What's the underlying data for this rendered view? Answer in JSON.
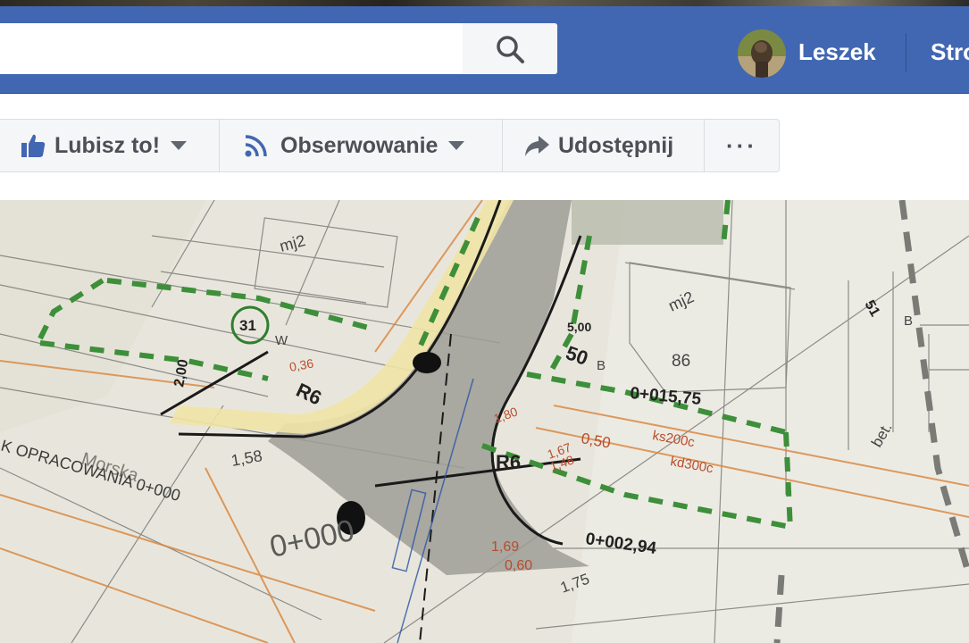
{
  "header": {
    "search": {
      "value": "",
      "placeholder": ""
    },
    "user": {
      "name": "Leszek"
    },
    "nav": {
      "home_label": "Stro"
    }
  },
  "page_actions": {
    "like_label": "Lubisz to!",
    "follow_label": "Obserwowanie",
    "share_label": "Udostępnij",
    "more_label": "···"
  },
  "cover": {
    "labels": {
      "parcel_31": "31",
      "parcel_50": "50",
      "parcel_86": "86",
      "parcel_51": "51",
      "radius_left": "R6",
      "radius_right": "R6",
      "chainage_upper": "0+015,75",
      "chainage_lower": "0+002,94",
      "chainage_zero": "0+000",
      "dim_200": "2,00",
      "dim_500": "5,00",
      "street": "Morska",
      "project_range": "K OPRACOWANIA 0+000",
      "ks200": "ks200c",
      "kd300": "kd300c",
      "val_050": "0,50",
      "val_169": "1,69",
      "val_060": "0,60",
      "val_167": "1,67",
      "val_148": "1,48",
      "val_158": "1,58",
      "val_036": "0,36",
      "val_180": "1,80",
      "label_bet": "bet.",
      "label_mj2a": "mj2",
      "label_mj2b": "mj2",
      "label_b1": "B",
      "label_b2": "B",
      "label_w": "W",
      "label_175": "1,75"
    },
    "colors": {
      "paper": "#e8e6dc",
      "road_gray": "#9e9c96",
      "sidewalk_yellow": "#efe4a6",
      "boundary_green": "#3d8f3a",
      "utility_orange": "#d9843c"
    }
  },
  "colors": {
    "topbar": "#4267b2",
    "button_bg": "#f5f6f7",
    "button_text": "#4b4f56",
    "like_icon": "#4267b2"
  }
}
